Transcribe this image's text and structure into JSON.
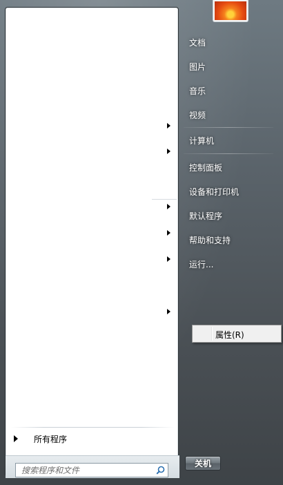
{
  "right_pane": {
    "items": [
      {
        "label": "文档"
      },
      {
        "label": "图片"
      },
      {
        "label": "音乐"
      },
      {
        "label": "视频"
      },
      {
        "label": "计算机"
      },
      {
        "label": "控制面板"
      },
      {
        "label": "设备和打印机"
      },
      {
        "label": "默认程序"
      },
      {
        "label": "帮助和支持"
      },
      {
        "label": "运行..."
      }
    ],
    "shutdown_label": "关机"
  },
  "left_pane": {
    "all_programs_label": "所有程序"
  },
  "search": {
    "placeholder": "搜索程序和文件",
    "icon": "search-icon"
  },
  "context_menu": {
    "items": [
      {
        "label": "属性(R)"
      }
    ]
  },
  "user": {
    "icon": "user-picture"
  },
  "colors": {
    "accent": "#ffffff",
    "panel_bg": "#5a636a"
  }
}
